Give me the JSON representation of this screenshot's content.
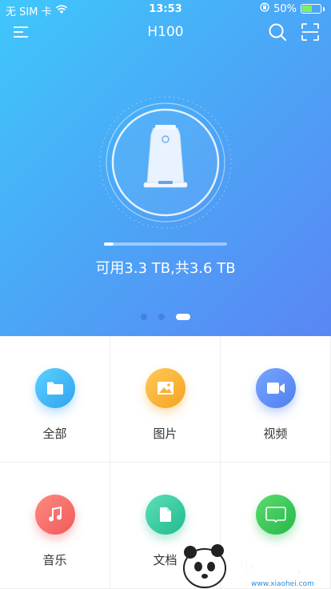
{
  "status_bar": {
    "carrier": "无 SIM 卡",
    "time": "13:53",
    "battery_percent": "50%",
    "battery_level": 0.5
  },
  "nav": {
    "title": "H100",
    "menu_icon": "menu-icon",
    "search_icon": "search-icon",
    "scan_icon": "scan-icon"
  },
  "device": {
    "storage_text": "可用3.3 TB,共3.6 TB",
    "used_fraction": 0.08
  },
  "pager": {
    "count": 3,
    "active_index": 2
  },
  "categories": [
    {
      "label": "全部",
      "icon": "folder-icon",
      "color": "#3fb5f5"
    },
    {
      "label": "图片",
      "icon": "image-icon",
      "color": "#f9b640"
    },
    {
      "label": "视频",
      "icon": "video-icon",
      "color": "#5b8ff4"
    },
    {
      "label": "音乐",
      "icon": "music-icon",
      "color": "#f46a6a"
    },
    {
      "label": "文档",
      "icon": "document-icon",
      "color": "#39c9a3"
    },
    {
      "label": "",
      "icon": "iqiyi-icon",
      "color": "#33c25a"
    }
  ],
  "watermark": {
    "brand": "小黑游戏",
    "url": "www.xiaohei.com"
  }
}
